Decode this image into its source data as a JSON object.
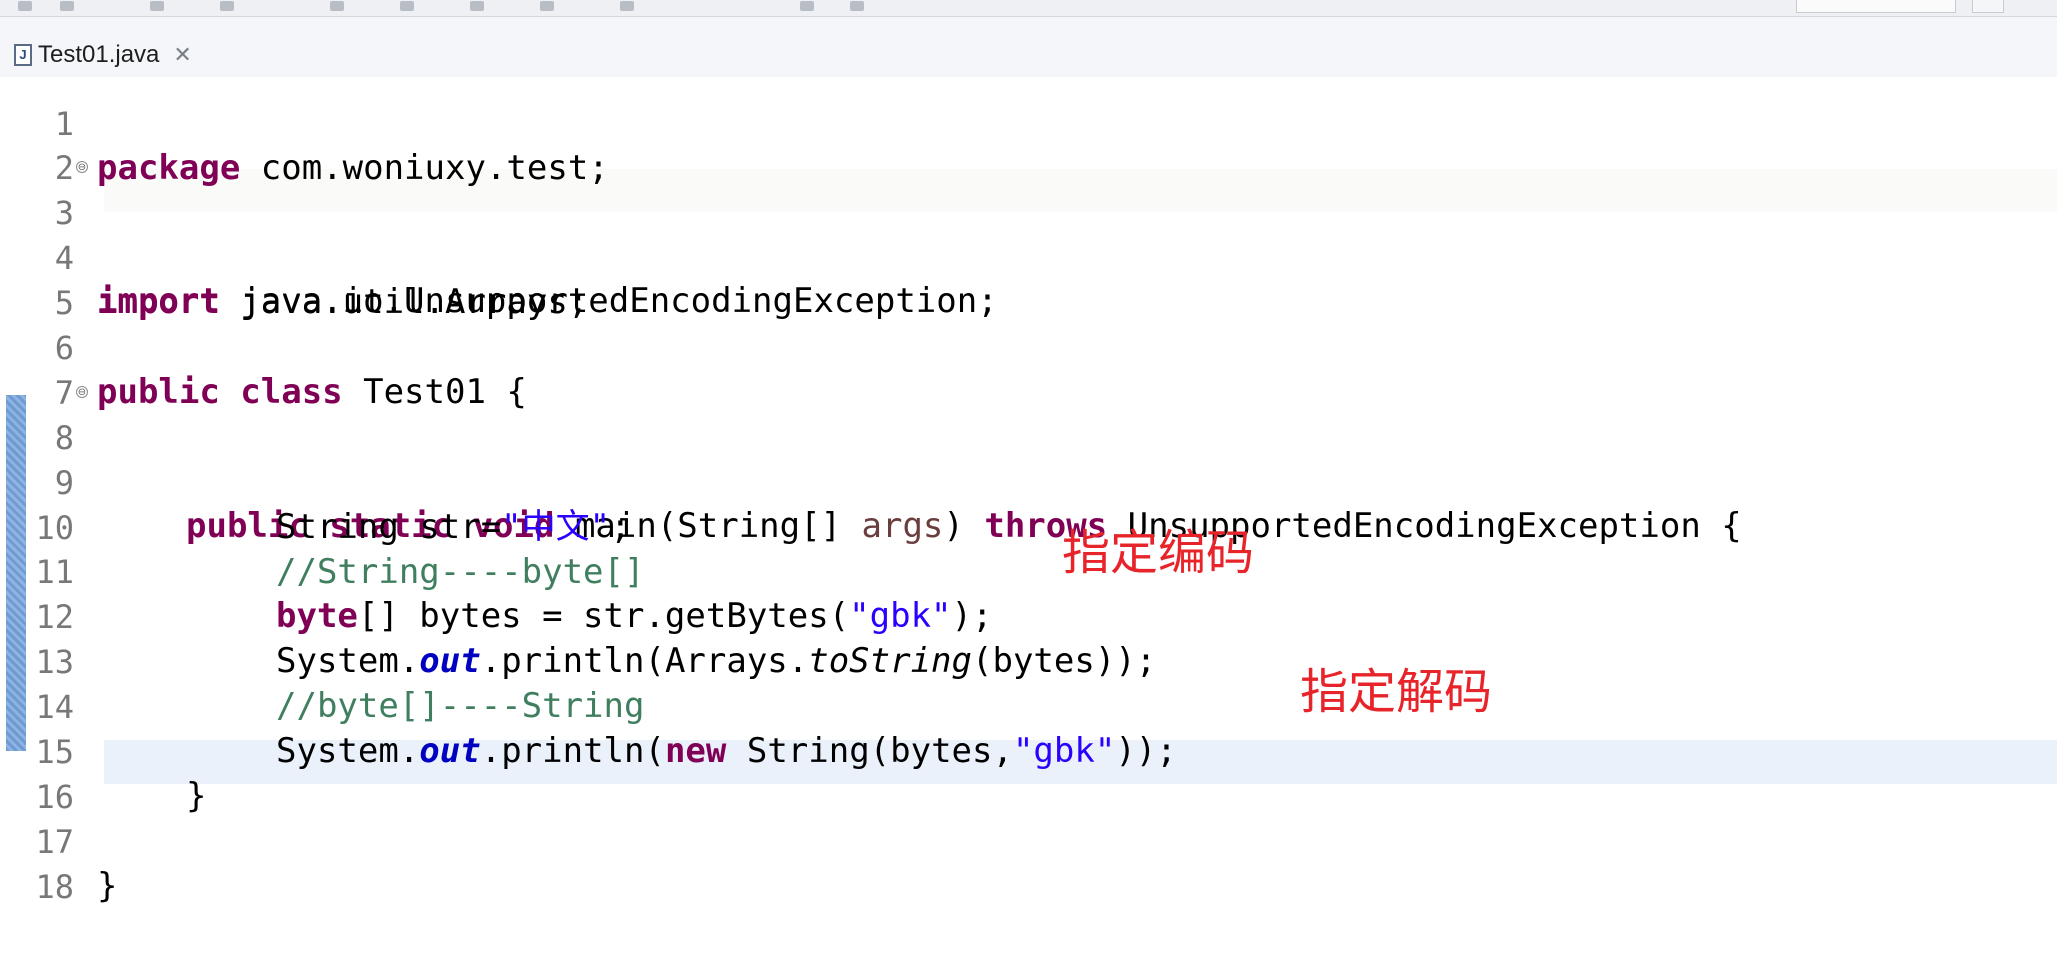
{
  "editor": {
    "tab_label": "Test01.java",
    "tab_close": "✕",
    "file_icon": "J",
    "fold_glyph": "⊖",
    "lines": [
      {
        "n": "1"
      },
      {
        "n": "2"
      },
      {
        "n": "3"
      },
      {
        "n": "4"
      },
      {
        "n": "5"
      },
      {
        "n": "6"
      },
      {
        "n": "7"
      },
      {
        "n": "8"
      },
      {
        "n": "9"
      },
      {
        "n": "10"
      },
      {
        "n": "11"
      },
      {
        "n": "12"
      },
      {
        "n": "13"
      },
      {
        "n": "14"
      },
      {
        "n": "15"
      },
      {
        "n": "16"
      },
      {
        "n": "17"
      },
      {
        "n": "18"
      }
    ],
    "code": {
      "l1_kw": "package",
      "l1_rest": " com.woniuxy.test;",
      "l3_kw": "import",
      "l3_rest": " java.io.UnsupportedEncodingException;",
      "l4_kw": "import",
      "l4_rest": " java.util.Arrays;",
      "l6_kw": "public class",
      "l6_rest": " Test01 {",
      "l8_kw": "public static void",
      "l8_a": " main(String[] ",
      "l8_param": "args",
      "l8_b": ") ",
      "l8_kw2": "throws",
      "l8_c": " UnsupportedEncodingException {",
      "l9_a": "String str=",
      "l9_str": "\"中文\"",
      "l9_b": ";",
      "l10_cm": "//String----byte[]",
      "l11_kw": "byte",
      "l11_a": "[] bytes = str.getBytes(",
      "l11_str": "\"gbk\"",
      "l11_b": ");",
      "l12_a": "System.",
      "l12_fld": "out",
      "l12_b": ".println(Arrays.",
      "l12_it": "toString",
      "l12_c": "(bytes));",
      "l13_cm": "//byte[]----String",
      "l14_a": "System.",
      "l14_fld": "out",
      "l14_b": ".println(",
      "l14_kw": "new",
      "l14_c": " String(bytes,",
      "l14_str": "\"gbk\"",
      "l14_d": "));",
      "l15": "}",
      "l17": "}"
    },
    "annotations": {
      "encode": "指定编码",
      "decode": "指定解码"
    }
  },
  "colors": {
    "keyword": "#7f0055",
    "string": "#2a00ff",
    "comment": "#3f7f5f",
    "static_field": "#0000c0",
    "annotation": "#e8242b",
    "current_line": "#eaf1fb"
  }
}
